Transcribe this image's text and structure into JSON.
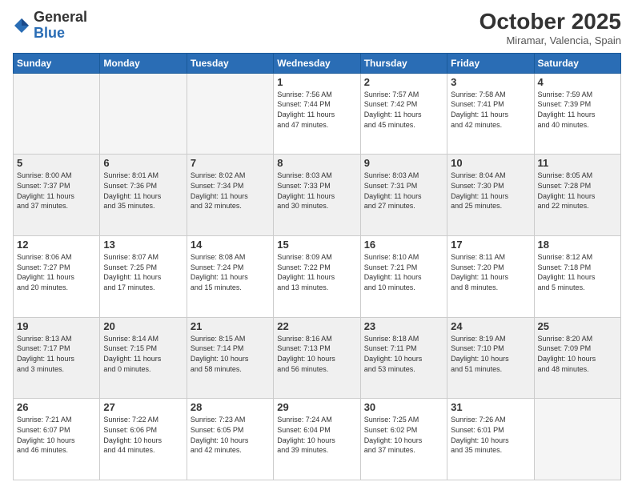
{
  "header": {
    "logo_general": "General",
    "logo_blue": "Blue",
    "month_title": "October 2025",
    "location": "Miramar, Valencia, Spain"
  },
  "weekdays": [
    "Sunday",
    "Monday",
    "Tuesday",
    "Wednesday",
    "Thursday",
    "Friday",
    "Saturday"
  ],
  "weeks": [
    [
      {
        "day": "",
        "info": ""
      },
      {
        "day": "",
        "info": ""
      },
      {
        "day": "",
        "info": ""
      },
      {
        "day": "1",
        "info": "Sunrise: 7:56 AM\nSunset: 7:44 PM\nDaylight: 11 hours\nand 47 minutes."
      },
      {
        "day": "2",
        "info": "Sunrise: 7:57 AM\nSunset: 7:42 PM\nDaylight: 11 hours\nand 45 minutes."
      },
      {
        "day": "3",
        "info": "Sunrise: 7:58 AM\nSunset: 7:41 PM\nDaylight: 11 hours\nand 42 minutes."
      },
      {
        "day": "4",
        "info": "Sunrise: 7:59 AM\nSunset: 7:39 PM\nDaylight: 11 hours\nand 40 minutes."
      }
    ],
    [
      {
        "day": "5",
        "info": "Sunrise: 8:00 AM\nSunset: 7:37 PM\nDaylight: 11 hours\nand 37 minutes."
      },
      {
        "day": "6",
        "info": "Sunrise: 8:01 AM\nSunset: 7:36 PM\nDaylight: 11 hours\nand 35 minutes."
      },
      {
        "day": "7",
        "info": "Sunrise: 8:02 AM\nSunset: 7:34 PM\nDaylight: 11 hours\nand 32 minutes."
      },
      {
        "day": "8",
        "info": "Sunrise: 8:03 AM\nSunset: 7:33 PM\nDaylight: 11 hours\nand 30 minutes."
      },
      {
        "day": "9",
        "info": "Sunrise: 8:03 AM\nSunset: 7:31 PM\nDaylight: 11 hours\nand 27 minutes."
      },
      {
        "day": "10",
        "info": "Sunrise: 8:04 AM\nSunset: 7:30 PM\nDaylight: 11 hours\nand 25 minutes."
      },
      {
        "day": "11",
        "info": "Sunrise: 8:05 AM\nSunset: 7:28 PM\nDaylight: 11 hours\nand 22 minutes."
      }
    ],
    [
      {
        "day": "12",
        "info": "Sunrise: 8:06 AM\nSunset: 7:27 PM\nDaylight: 11 hours\nand 20 minutes."
      },
      {
        "day": "13",
        "info": "Sunrise: 8:07 AM\nSunset: 7:25 PM\nDaylight: 11 hours\nand 17 minutes."
      },
      {
        "day": "14",
        "info": "Sunrise: 8:08 AM\nSunset: 7:24 PM\nDaylight: 11 hours\nand 15 minutes."
      },
      {
        "day": "15",
        "info": "Sunrise: 8:09 AM\nSunset: 7:22 PM\nDaylight: 11 hours\nand 13 minutes."
      },
      {
        "day": "16",
        "info": "Sunrise: 8:10 AM\nSunset: 7:21 PM\nDaylight: 11 hours\nand 10 minutes."
      },
      {
        "day": "17",
        "info": "Sunrise: 8:11 AM\nSunset: 7:20 PM\nDaylight: 11 hours\nand 8 minutes."
      },
      {
        "day": "18",
        "info": "Sunrise: 8:12 AM\nSunset: 7:18 PM\nDaylight: 11 hours\nand 5 minutes."
      }
    ],
    [
      {
        "day": "19",
        "info": "Sunrise: 8:13 AM\nSunset: 7:17 PM\nDaylight: 11 hours\nand 3 minutes."
      },
      {
        "day": "20",
        "info": "Sunrise: 8:14 AM\nSunset: 7:15 PM\nDaylight: 11 hours\nand 0 minutes."
      },
      {
        "day": "21",
        "info": "Sunrise: 8:15 AM\nSunset: 7:14 PM\nDaylight: 10 hours\nand 58 minutes."
      },
      {
        "day": "22",
        "info": "Sunrise: 8:16 AM\nSunset: 7:13 PM\nDaylight: 10 hours\nand 56 minutes."
      },
      {
        "day": "23",
        "info": "Sunrise: 8:18 AM\nSunset: 7:11 PM\nDaylight: 10 hours\nand 53 minutes."
      },
      {
        "day": "24",
        "info": "Sunrise: 8:19 AM\nSunset: 7:10 PM\nDaylight: 10 hours\nand 51 minutes."
      },
      {
        "day": "25",
        "info": "Sunrise: 8:20 AM\nSunset: 7:09 PM\nDaylight: 10 hours\nand 48 minutes."
      }
    ],
    [
      {
        "day": "26",
        "info": "Sunrise: 7:21 AM\nSunset: 6:07 PM\nDaylight: 10 hours\nand 46 minutes."
      },
      {
        "day": "27",
        "info": "Sunrise: 7:22 AM\nSunset: 6:06 PM\nDaylight: 10 hours\nand 44 minutes."
      },
      {
        "day": "28",
        "info": "Sunrise: 7:23 AM\nSunset: 6:05 PM\nDaylight: 10 hours\nand 42 minutes."
      },
      {
        "day": "29",
        "info": "Sunrise: 7:24 AM\nSunset: 6:04 PM\nDaylight: 10 hours\nand 39 minutes."
      },
      {
        "day": "30",
        "info": "Sunrise: 7:25 AM\nSunset: 6:02 PM\nDaylight: 10 hours\nand 37 minutes."
      },
      {
        "day": "31",
        "info": "Sunrise: 7:26 AM\nSunset: 6:01 PM\nDaylight: 10 hours\nand 35 minutes."
      },
      {
        "day": "",
        "info": ""
      }
    ]
  ]
}
